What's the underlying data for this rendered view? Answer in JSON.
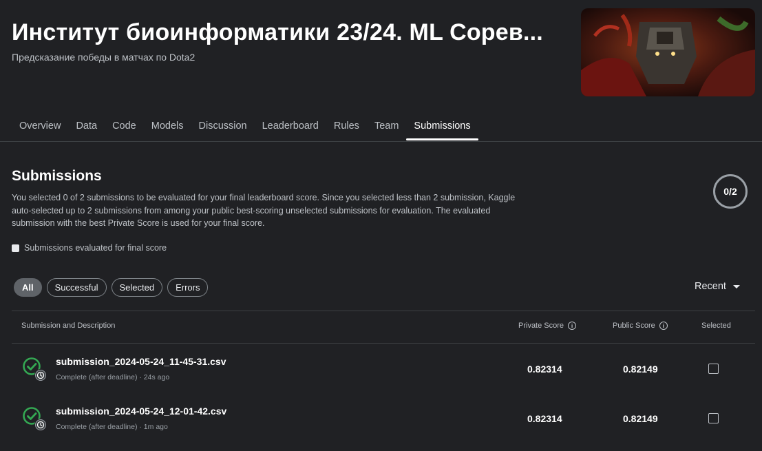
{
  "header": {
    "title": "Институт биоинформатики 23/24. ML Сорев...",
    "subtitle": "Предсказание победы в матчах по Dota2"
  },
  "tabs": [
    {
      "label": "Overview"
    },
    {
      "label": "Data"
    },
    {
      "label": "Code"
    },
    {
      "label": "Models"
    },
    {
      "label": "Discussion"
    },
    {
      "label": "Leaderboard"
    },
    {
      "label": "Rules"
    },
    {
      "label": "Team"
    },
    {
      "label": "Submissions",
      "active": true
    }
  ],
  "submissions": {
    "title": "Submissions",
    "description": "You selected 0 of 2 submissions to be evaluated for your final leaderboard score. Since you selected less than 2 submission, Kaggle auto-selected up to 2 submissions from among your public best-scoring unselected submissions for evaluation. The evaluated submission with the best Private Score is used for your final score.",
    "count_badge": "0/2",
    "legend_label": "Submissions evaluated for final score"
  },
  "filters": {
    "chips": [
      "All",
      "Successful",
      "Selected",
      "Errors"
    ],
    "active": "All",
    "sort_label": "Recent"
  },
  "table": {
    "headers": {
      "description": "Submission and Description",
      "private": "Private Score",
      "public": "Public Score",
      "selected": "Selected"
    },
    "rows": [
      {
        "file": "submission_2024-05-24_11-45-31.csv",
        "meta": "Complete (after deadline) · 24s ago",
        "private_score": "0.82314",
        "public_score": "0.82149"
      },
      {
        "file": "submission_2024-05-24_12-01-42.csv",
        "meta": "Complete (after deadline) · 1m ago",
        "private_score": "0.82314",
        "public_score": "0.82149"
      }
    ]
  },
  "colors": {
    "background": "#202124",
    "success": "#34a853",
    "text_primary": "#ffffff",
    "text_secondary": "#bdc1c6"
  }
}
